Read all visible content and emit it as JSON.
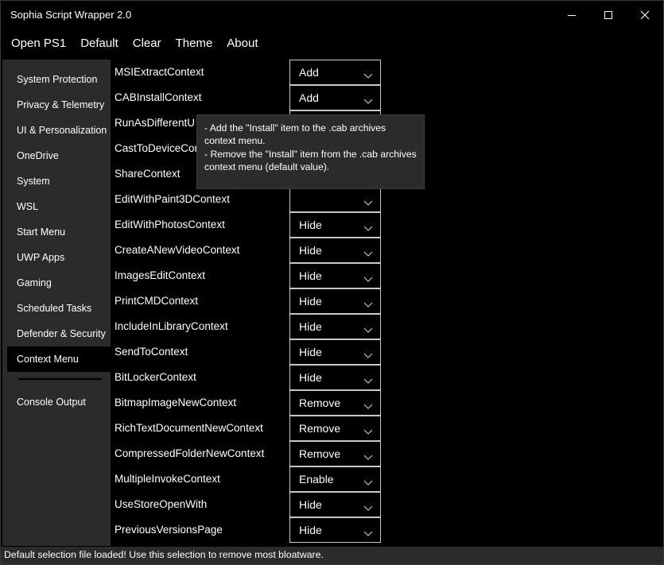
{
  "window": {
    "title": "Sophia Script Wrapper 2.0"
  },
  "menu": {
    "items": [
      {
        "label": "Open PS1"
      },
      {
        "label": "Default"
      },
      {
        "label": "Clear"
      },
      {
        "label": "Theme"
      },
      {
        "label": "About"
      }
    ]
  },
  "sidebar": {
    "items": [
      {
        "label": "System Protection"
      },
      {
        "label": "Privacy & Telemetry"
      },
      {
        "label": "UI & Personalization"
      },
      {
        "label": "OneDrive"
      },
      {
        "label": "System"
      },
      {
        "label": "WSL"
      },
      {
        "label": "Start Menu"
      },
      {
        "label": "UWP Apps"
      },
      {
        "label": "Gaming"
      },
      {
        "label": "Scheduled Tasks"
      },
      {
        "label": "Defender & Security"
      },
      {
        "label": "Context Menu"
      }
    ],
    "active": "Context Menu",
    "console_label": "Console Output"
  },
  "settings": [
    {
      "name": "MSIExtractContext",
      "value": "Add"
    },
    {
      "name": "CABInstallContext",
      "value": "Add"
    },
    {
      "name": "RunAsDifferentU",
      "value": ""
    },
    {
      "name": "CastToDeviceCor",
      "value": ""
    },
    {
      "name": "ShareContext",
      "value": ""
    },
    {
      "name": "EditWithPaint3DContext",
      "value": ""
    },
    {
      "name": "EditWithPhotosContext",
      "value": "Hide"
    },
    {
      "name": "CreateANewVideoContext",
      "value": "Hide"
    },
    {
      "name": "ImagesEditContext",
      "value": "Hide"
    },
    {
      "name": "PrintCMDContext",
      "value": "Hide"
    },
    {
      "name": "IncludeInLibraryContext",
      "value": "Hide"
    },
    {
      "name": "SendToContext",
      "value": "Hide"
    },
    {
      "name": "BitLockerContext",
      "value": "Hide"
    },
    {
      "name": "BitmapImageNewContext",
      "value": "Remove"
    },
    {
      "name": "RichTextDocumentNewContext",
      "value": "Remove"
    },
    {
      "name": "CompressedFolderNewContext",
      "value": "Remove"
    },
    {
      "name": "MultipleInvokeContext",
      "value": "Enable"
    },
    {
      "name": "UseStoreOpenWith",
      "value": "Hide"
    },
    {
      "name": "PreviousVersionsPage",
      "value": "Hide"
    }
  ],
  "tooltip": {
    "line1": "- Add the \"Install\" item to the .cab archives context menu.",
    "line2": "- Remove the \"Install\" item from the .cab archives context menu (default value)."
  },
  "status": {
    "text": "Default selection file loaded! Use this selection to remove most bloatware."
  },
  "colors": {
    "background": "#000000",
    "panel": "#2b2b2b",
    "text": "#ffffff",
    "border": "#c8c8c8"
  }
}
